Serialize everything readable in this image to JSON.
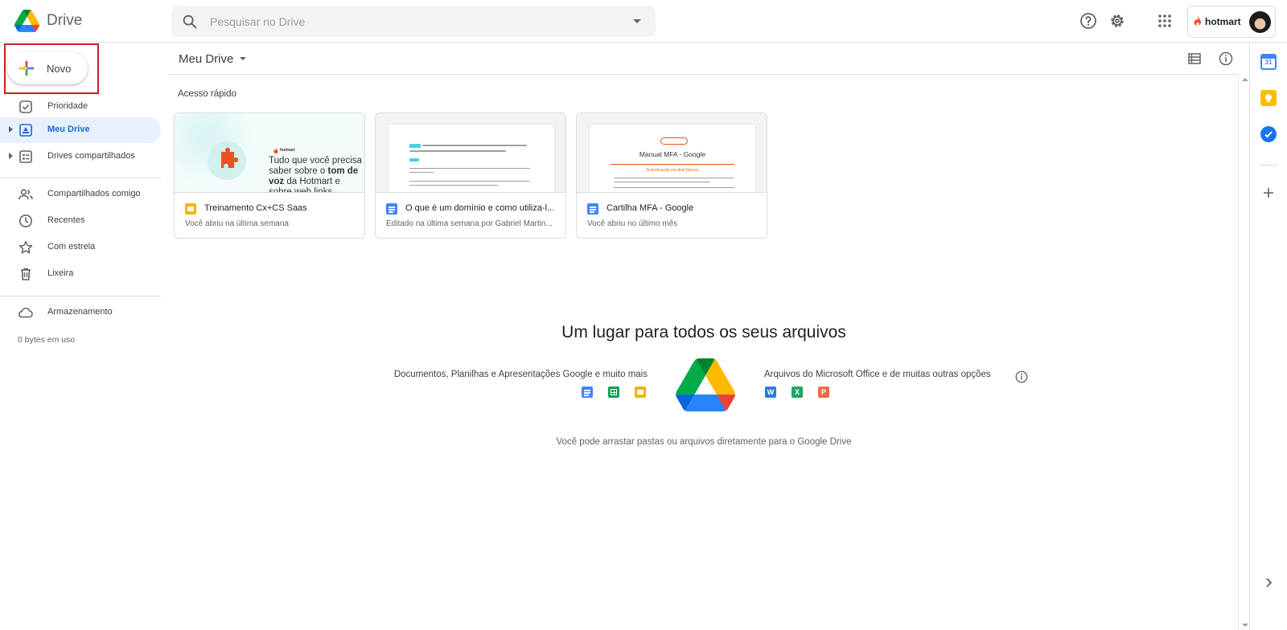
{
  "header": {
    "app_name": "Drive",
    "search_placeholder": "Pesquisar no Drive",
    "account_brand": "hotmart"
  },
  "sidebar": {
    "new_button": "Novo",
    "items": [
      {
        "label": "Prioridade"
      },
      {
        "label": "Meu Drive"
      },
      {
        "label": "Drives compartilhados"
      },
      {
        "label": "Compartilhados comigo"
      },
      {
        "label": "Recentes"
      },
      {
        "label": "Com estrela"
      },
      {
        "label": "Lixeira"
      },
      {
        "label": "Armazenamento"
      }
    ],
    "storage_usage": "0 bytes em uso"
  },
  "main": {
    "title": "Meu Drive",
    "quick_access_label": "Acesso rápido",
    "cards": [
      {
        "name": "Treinamento Cx+CS Saas",
        "subtitle": "Você abriu na última semana",
        "type": "slides",
        "thumb_brand": "hotmart",
        "thumb_text_pre": "Tudo que você precisa saber sobre o ",
        "thumb_text_bold": "tom de voz",
        "thumb_text_post": " da Hotmart e sobre web links"
      },
      {
        "name": "O que é um domínio e como utiliza-l...",
        "subtitle": "Editado na última semana por Gabriel Martin...",
        "type": "docs"
      },
      {
        "name": "Cartilha MFA - Google",
        "subtitle": "Você abriu no último mês",
        "type": "docs",
        "thumb_title": "Manual MFA - Google",
        "thumb_subtitle": "Autenticação em dois fatores"
      }
    ],
    "empty_title": "Um lugar para todos os seus arquivos",
    "google_desc": "Documentos, Planilhas e Apresentações Google e muito mais",
    "office_desc": "Arquivos do Microsoft Office e de muitas outras opções",
    "office_letters": [
      "W",
      "X",
      "P"
    ],
    "drag_hint": "Você pode arrastar pastas ou arquivos diretamente para o Google Drive"
  },
  "rightbar": {
    "calendar_day": "31"
  },
  "colors": {
    "accent_blue": "#1a73e8",
    "active_bg": "#e8f0fe",
    "docs_blue": "#4285f4",
    "sheets_green": "#0f9d58",
    "slides_yellow": "#f4b400",
    "word_blue": "#2b7cd3",
    "excel_green": "#21a366",
    "ppt_orange": "#ed6c47",
    "hotmart_orange": "#f04e23",
    "highlight_red": "#c5221f"
  }
}
